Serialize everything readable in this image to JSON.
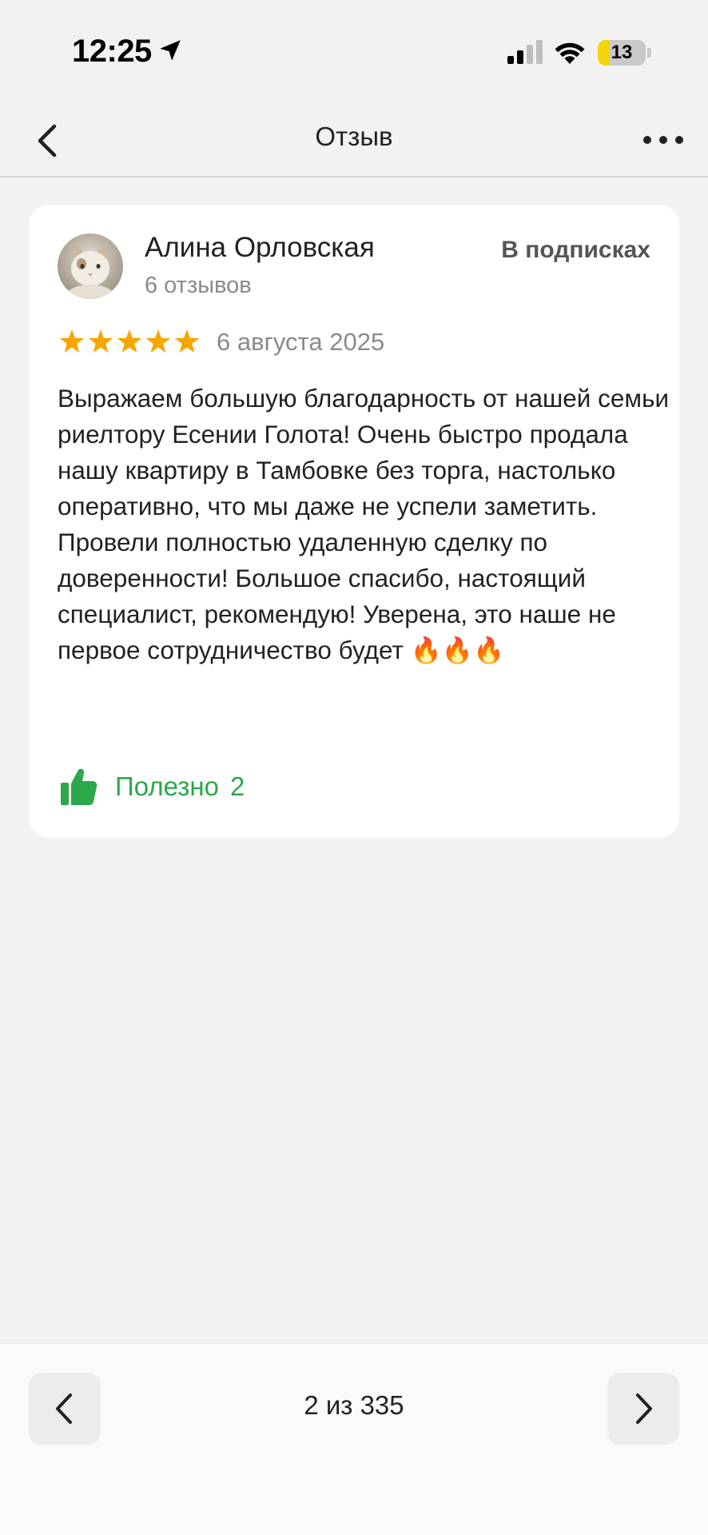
{
  "status_bar": {
    "time": "12:25",
    "battery_level": "13",
    "icons": [
      "location-arrow-icon",
      "cellular-signal-icon",
      "wifi-icon",
      "battery-icon"
    ]
  },
  "header": {
    "title": "Отзыв",
    "back_icon": "chevron-left-icon",
    "more_icon": "more-dots-icon"
  },
  "review": {
    "author_name": "Алина Орловская",
    "reviews_count": "6 отзывов",
    "subscribed_label": "В подписках",
    "rating": 5,
    "rating_max": 5,
    "date": "6 августа 2025",
    "text": "Выражаем большую благодарность от нашей семьи риелтору Есении Голота! Очень быстро продала нашу квартиру в Тамбовке без торга, настолько оперативно, что мы даже не успели заметить. Провели полностью удаленную сделку по доверенности! Большое спасибо, настоящий специалист, рекомендую! Уверена, это наше не первое сотрудничество будет 🔥🔥🔥",
    "helpful_label": "Полезно",
    "helpful_count": "2"
  },
  "pager": {
    "text": "2 из 335"
  },
  "colors": {
    "accent_green": "#2aa84a",
    "star": "#f5a700",
    "background": "#f2f2f2"
  }
}
